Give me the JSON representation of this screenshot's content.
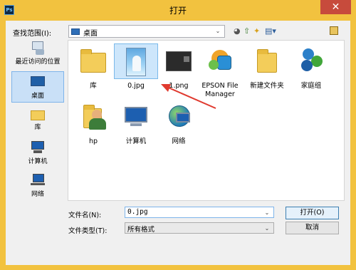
{
  "window": {
    "app_icon_text": "Ps",
    "title": "打开",
    "close_glyph": "✕"
  },
  "toolbar": {
    "look_in_label": "查找范围(I):",
    "look_in_value": "桌面",
    "dropdown_glyph": "⌄",
    "back_glyph": "◕",
    "up_glyph": "⇧",
    "new_folder_glyph": "✦",
    "views_glyph": "▤▾"
  },
  "places": [
    {
      "label": "最近访问的位置",
      "icon": "recent-places-icon"
    },
    {
      "label": "桌面",
      "icon": "desktop-icon",
      "selected": true
    },
    {
      "label": "库",
      "icon": "libraries-icon"
    },
    {
      "label": "计算机",
      "icon": "computer-icon"
    },
    {
      "label": "网络",
      "icon": "network-icon"
    }
  ],
  "files": [
    {
      "label": "库",
      "icon": "libraries-folder-icon"
    },
    {
      "label": "0.jpg",
      "icon": "photo-thumbnail-icon",
      "selected": true
    },
    {
      "label": "1.png",
      "icon": "image-thumbnail-icon"
    },
    {
      "label": "EPSON File Manager",
      "icon": "epson-app-icon"
    },
    {
      "label": "新建文件夹",
      "icon": "folder-icon"
    },
    {
      "label": "家庭组",
      "icon": "homegroup-icon"
    },
    {
      "label": "hp",
      "icon": "user-folder-icon"
    },
    {
      "label": "计算机",
      "icon": "computer-icon"
    },
    {
      "label": "网络",
      "icon": "network-icon"
    }
  ],
  "bottom": {
    "filename_label": "文件名(N):",
    "filename_value": "0.jpg",
    "filetype_label": "文件类型(T):",
    "filetype_value": "所有格式",
    "open_button": "打开(O)",
    "cancel_button": "取消"
  },
  "colors": {
    "frame": "#f2c23f",
    "close": "#c74b3c",
    "annotation_arrow": "#e03a2f",
    "selection": "#cde6fb"
  }
}
